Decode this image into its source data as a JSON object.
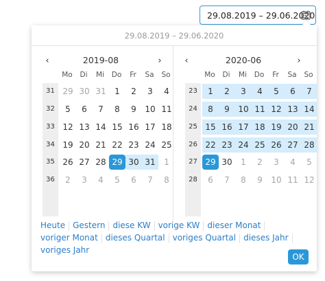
{
  "input": {
    "value": "29.08.2019 – 29.06.2020",
    "icon": "calendar-icon"
  },
  "popup": {
    "header": "29.08.2019 – 29.06.2020"
  },
  "weekday_headers": [
    "Mo",
    "Di",
    "Mi",
    "Do",
    "Fr",
    "Sa",
    "So"
  ],
  "left_month": {
    "title": "2019-08",
    "prev": "‹",
    "next": "›",
    "weeks": [
      "31",
      "32",
      "33",
      "34",
      "35",
      "36"
    ],
    "days": [
      [
        "29",
        "30",
        "31",
        "1",
        "2",
        "3",
        "4"
      ],
      [
        "5",
        "6",
        "7",
        "8",
        "9",
        "10",
        "11"
      ],
      [
        "12",
        "13",
        "14",
        "15",
        "16",
        "17",
        "18"
      ],
      [
        "19",
        "20",
        "21",
        "22",
        "23",
        "24",
        "25"
      ],
      [
        "26",
        "27",
        "28",
        "29",
        "30",
        "31",
        "1"
      ],
      [
        "2",
        "3",
        "4",
        "5",
        "6",
        "7",
        "8"
      ]
    ]
  },
  "right_month": {
    "title": "2020-06",
    "prev": "‹",
    "next": "›",
    "weeks": [
      "23",
      "24",
      "25",
      "26",
      "27",
      "28"
    ],
    "days": [
      [
        "1",
        "2",
        "3",
        "4",
        "5",
        "6",
        "7"
      ],
      [
        "8",
        "9",
        "10",
        "11",
        "12",
        "13",
        "14"
      ],
      [
        "15",
        "16",
        "17",
        "18",
        "19",
        "20",
        "21"
      ],
      [
        "22",
        "23",
        "24",
        "25",
        "26",
        "27",
        "28"
      ],
      [
        "29",
        "30",
        "1",
        "2",
        "3",
        "4",
        "5"
      ],
      [
        "6",
        "7",
        "8",
        "9",
        "10",
        "11",
        "12"
      ]
    ]
  },
  "presets": [
    [
      "Heute",
      "Gestern",
      "diese KW",
      "vorige KW",
      "dieser Monat"
    ],
    [
      "voriger Monat",
      "dieses Quartal",
      "voriges Quartal",
      "dieses Jahr"
    ],
    [
      "voriges Jahr"
    ]
  ],
  "ok_label": "OK",
  "colors": {
    "accent": "#2a98d8",
    "range": "#d4ecfb",
    "link": "#2a7ec9"
  }
}
